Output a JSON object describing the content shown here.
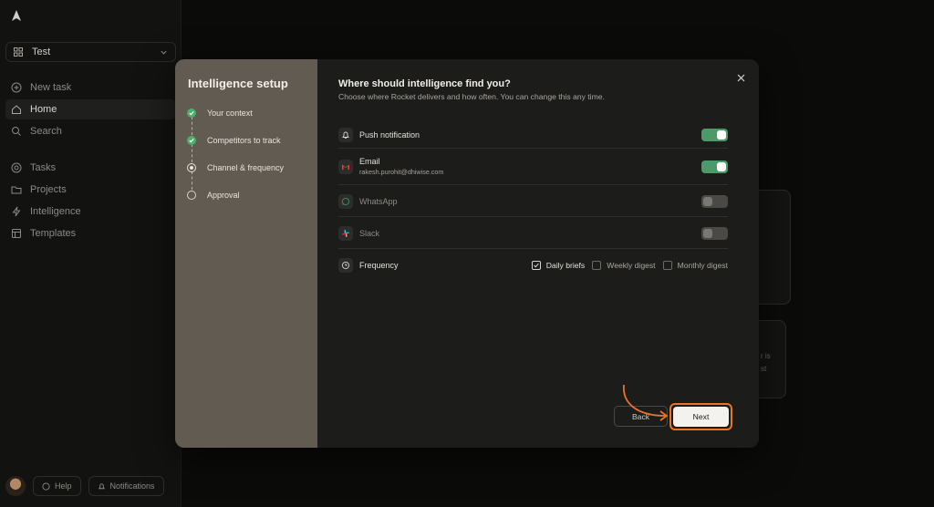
{
  "sidebar": {
    "workspace": "Test",
    "items": [
      {
        "label": "New task",
        "icon": "plus-circle-icon"
      },
      {
        "label": "Home",
        "icon": "home-icon"
      },
      {
        "label": "Search",
        "icon": "search-icon"
      },
      {
        "label": "Tasks",
        "icon": "tasks-icon"
      },
      {
        "label": "Projects",
        "icon": "folder-icon"
      },
      {
        "label": "Intelligence",
        "icon": "bolt-icon"
      },
      {
        "label": "Templates",
        "icon": "templates-icon"
      }
    ],
    "help_label": "Help",
    "notifications_label": "Notifications"
  },
  "background": {
    "card_text_1": "r is",
    "card_text_2": "st"
  },
  "modal": {
    "left_title": "Intelligence setup",
    "steps": [
      {
        "label": "Your context",
        "state": "done"
      },
      {
        "label": "Competitors to track",
        "state": "done"
      },
      {
        "label": "Channel & frequency",
        "state": "current"
      },
      {
        "label": "Approval",
        "state": "pending"
      }
    ],
    "heading": "Where should intelligence find you?",
    "subheading": "Choose where Rocket delivers and how often. You can change this any time.",
    "channels": [
      {
        "label": "Push notification",
        "sub": "",
        "enabled": true,
        "icon": "bell-icon"
      },
      {
        "label": "Email",
        "sub": "rakesh.purohit@dhiwise.com",
        "enabled": true,
        "icon": "gmail-icon"
      },
      {
        "label": "WhatsApp",
        "sub": "",
        "enabled": false,
        "icon": "whatsapp-icon"
      },
      {
        "label": "Slack",
        "sub": "",
        "enabled": false,
        "icon": "slack-icon"
      }
    ],
    "frequency": {
      "label": "Frequency",
      "options": [
        {
          "label": "Daily briefs",
          "checked": true
        },
        {
          "label": "Weekly digest",
          "checked": false
        },
        {
          "label": "Monthly digest",
          "checked": false
        }
      ]
    },
    "back_label": "Back",
    "next_label": "Next"
  },
  "colors": {
    "accent_green": "#4b9a68",
    "highlight_orange": "#e8732a",
    "left_panel": "#615b52"
  }
}
